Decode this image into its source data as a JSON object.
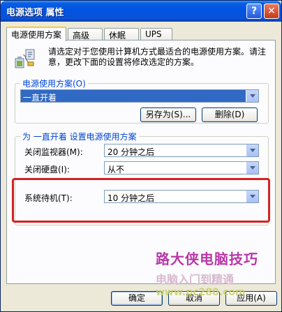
{
  "window": {
    "title": "电源选项 属性",
    "help_glyph": "?",
    "close_glyph": "✕"
  },
  "tabs": [
    {
      "label": "电源使用方案",
      "active": true
    },
    {
      "label": "高级",
      "active": false
    },
    {
      "label": "休眠",
      "active": false
    },
    {
      "label": "UPS",
      "active": false
    }
  ],
  "intro": {
    "icon": "battery-power-icon",
    "text": "请选定对于您使用计算机方式最适合的电源使用方案。请注意，更改下面的设置将修改选定的方案。"
  },
  "scheme_group": {
    "label": "电源使用方案(O)",
    "selected": "一直开着",
    "save_as_button": "另存为(S)...",
    "delete_button": "删除(D)"
  },
  "settings_group": {
    "label": "为 一直开着 设置电源使用方案",
    "rows": [
      {
        "label": "关闭监视器(M):",
        "value": "20 分钟之后"
      },
      {
        "label": "关闭硬盘(I):",
        "value": "从不"
      },
      {
        "label": "系统待机(T):",
        "value": "10 分钟之后"
      }
    ]
  },
  "footer": {
    "ok": "确定",
    "cancel": "取消",
    "apply": "应用(A)"
  },
  "watermark": {
    "line1": "路大侠电脑技巧",
    "line2": "电脑入门到精通",
    "line3": "www.pc280.com"
  },
  "colors": {
    "titlebar": "#0054e3",
    "group_label": "#0046d5",
    "highlight_box": "#d42222",
    "selection": "#316ac5"
  }
}
